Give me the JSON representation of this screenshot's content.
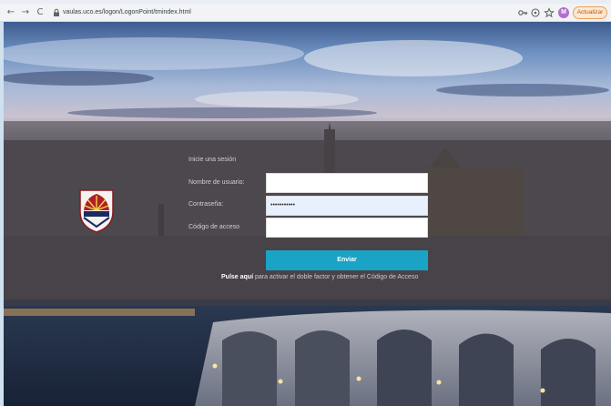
{
  "browser": {
    "back": "←",
    "forward": "→",
    "reload": "C",
    "url": "vaulas.uco.es/logon/LogonPoint/tmindex.html",
    "profile_initial": "M",
    "update_label": "Actualizar"
  },
  "login": {
    "signin_title": "Inicie una sesión",
    "username_label": "Nombre de usuario:",
    "username_value": "",
    "password_label": "Contraseña:",
    "password_value": "•••••••••••",
    "code_label": "Código de acceso",
    "code_value": "",
    "submit_label": "Enviar",
    "hint_link": "Pulse aquí",
    "hint_rest": " para activar el doble factor y obtener el Código de Acceso"
  },
  "colors": {
    "accent": "#1aa3c5",
    "panel": "#464042"
  },
  "icons": [
    "lock-icon",
    "key-icon",
    "share-icon",
    "star-icon",
    "menu-icon",
    "university-shield-icon"
  ]
}
